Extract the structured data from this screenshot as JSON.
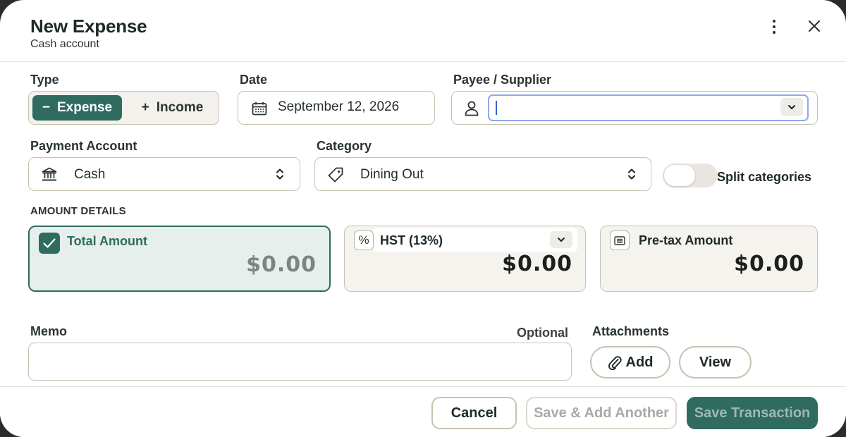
{
  "header": {
    "title": "New Expense",
    "subtitle": "Cash account"
  },
  "type": {
    "label": "Type",
    "options": [
      {
        "symbol": "−",
        "label": "Expense",
        "selected": true
      },
      {
        "symbol": "+",
        "label": "Income",
        "selected": false
      }
    ]
  },
  "date": {
    "label": "Date",
    "value": "September 12, 2026"
  },
  "payee": {
    "label": "Payee / Supplier",
    "value": ""
  },
  "payment_account": {
    "label": "Payment Account",
    "value": "Cash"
  },
  "category": {
    "label": "Category",
    "value": "Dining Out"
  },
  "split": {
    "label": "Split categories",
    "enabled": false
  },
  "amount_details": {
    "label": "AMOUNT DETAILS",
    "total": {
      "label": "Total Amount",
      "value": "$0.00",
      "checked": true
    },
    "tax": {
      "label": "HST (13%)",
      "value": "$0.00"
    },
    "pretax": {
      "label": "Pre-tax Amount",
      "value": "$0.00"
    }
  },
  "memo": {
    "label": "Memo",
    "hint": "Optional",
    "value": ""
  },
  "attachments": {
    "label": "Attachments",
    "add_label": "Add",
    "view_label": "View"
  },
  "footer": {
    "cancel_label": "Cancel",
    "save_another_label": "Save & Add Another",
    "save_label": "Save Transaction"
  },
  "colors": {
    "accent": "#2f6b5f",
    "border": "#c9c2b2",
    "focus": "#8fa9e6"
  }
}
